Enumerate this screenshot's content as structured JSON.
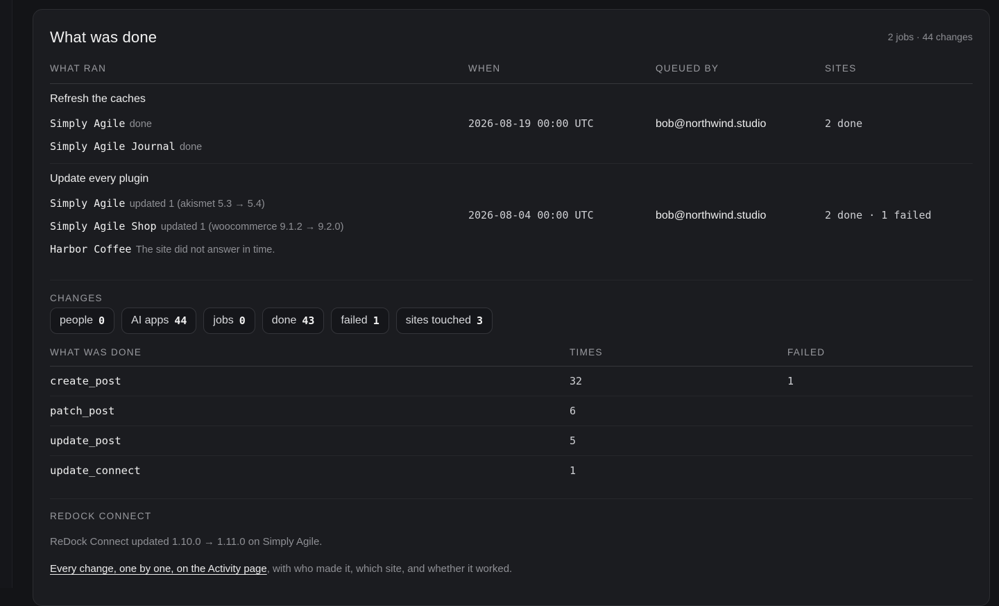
{
  "header": {
    "title": "What was done",
    "summary": "2 jobs · 44 changes"
  },
  "jobs_table": {
    "columns": [
      "WHAT RAN",
      "WHEN",
      "QUEUED BY",
      "SITES"
    ],
    "rows": [
      {
        "title": "Refresh the caches",
        "sites": [
          {
            "name": "Simply Agile",
            "status": "done"
          },
          {
            "name": "Simply Agile Journal",
            "status": "done"
          }
        ],
        "when": "2026-08-19 00:00 UTC",
        "queued_by": "bob@northwind.studio",
        "sites_summary": "2 done"
      },
      {
        "title": "Update every plugin",
        "sites": [
          {
            "name": "Simply Agile",
            "status": "updated 1 (akismet 5.3 → 5.4)"
          },
          {
            "name": "Simply Agile Shop",
            "status": "updated 1 (woocommerce 9.1.2 → 9.2.0)"
          },
          {
            "name": "Harbor Coffee",
            "status": "The site did not answer in time."
          }
        ],
        "when": "2026-08-04 00:00 UTC",
        "queued_by": "bob@northwind.studio",
        "sites_summary": "2 done · 1 failed"
      }
    ]
  },
  "changes": {
    "label": "CHANGES",
    "chips": [
      {
        "label": "people",
        "value": "0"
      },
      {
        "label": "AI apps",
        "value": "44"
      },
      {
        "label": "jobs",
        "value": "0"
      },
      {
        "label": "done",
        "value": "43"
      },
      {
        "label": "failed",
        "value": "1"
      },
      {
        "label": "sites touched",
        "value": "3"
      }
    ]
  },
  "actions_table": {
    "columns": [
      "WHAT WAS DONE",
      "TIMES",
      "FAILED"
    ],
    "rows": [
      {
        "action": "create_post",
        "times": "32",
        "failed": "1"
      },
      {
        "action": "patch_post",
        "times": "6",
        "failed": ""
      },
      {
        "action": "update_post",
        "times": "5",
        "failed": ""
      },
      {
        "action": "update_connect",
        "times": "1",
        "failed": ""
      }
    ]
  },
  "redock_connect": {
    "label": "REDOCK CONNECT",
    "text": "ReDock Connect updated 1.10.0 → 1.11.0 on Simply Agile.",
    "activity_link": "Every change, one by one, on the Activity page",
    "activity_suffix": ", with who made it, which site, and whether it worked."
  }
}
